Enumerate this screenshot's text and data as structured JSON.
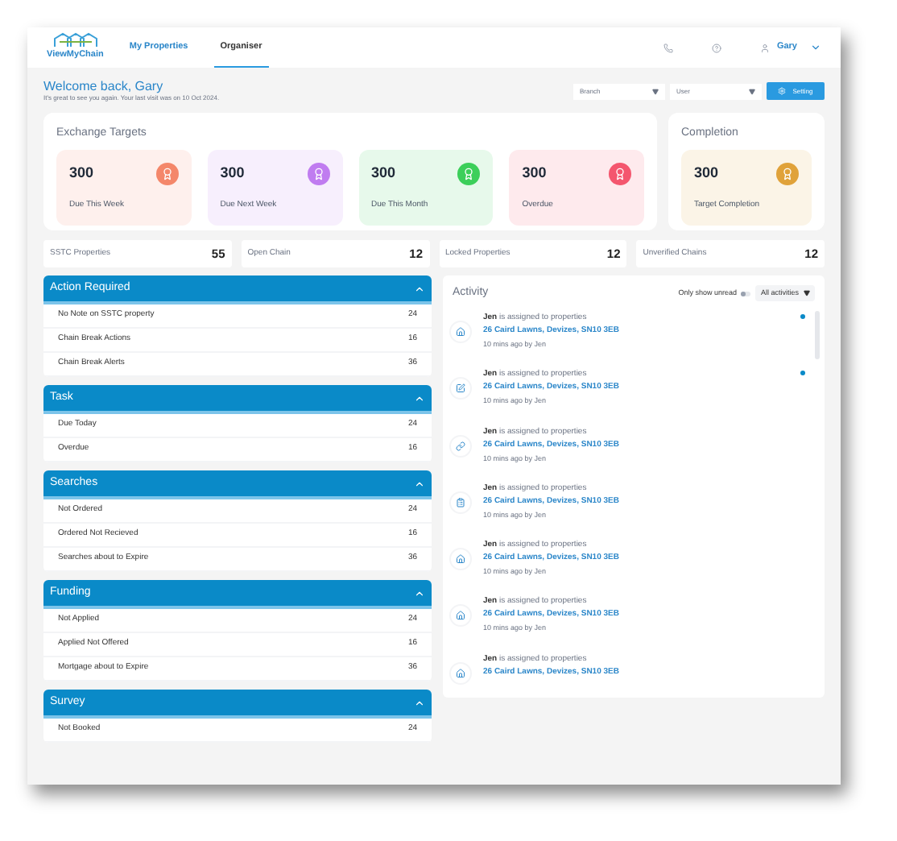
{
  "nav": {
    "logo": "ViewMyChain",
    "tabs": [
      {
        "label": "My Properties",
        "selected": false
      },
      {
        "label": "Organiser",
        "selected": true
      }
    ],
    "user": "Gary"
  },
  "welcome": {
    "title": "Welcome back, Gary",
    "subtitle": "It's great to see you again. Your last visit was on 10 Oct 2024."
  },
  "filters": [
    {
      "placeholder": "Branch"
    },
    {
      "placeholder": "User"
    }
  ],
  "setting_button": "Setting",
  "exchange_targets": {
    "title": "Exchange Targets",
    "cards": [
      {
        "value": "300",
        "label": "Due This Week",
        "color": "#f4876a"
      },
      {
        "value": "300",
        "label": "Due Next Week",
        "color": "#c07cf0"
      },
      {
        "value": "300",
        "label": "Due This Month",
        "color": "#3ccf5a"
      },
      {
        "value": "300",
        "label": "Overdue",
        "color": "#f4566e"
      }
    ]
  },
  "completion": {
    "title": "Completion",
    "cards": [
      {
        "value": "300",
        "label": "Target Completion",
        "color": "#e0a23a"
      }
    ]
  },
  "stats": [
    {
      "label": "SSTC Properties",
      "value": "55"
    },
    {
      "label": "Open Chain",
      "value": "12"
    },
    {
      "label": "Locked Properties",
      "value": "12"
    },
    {
      "label": "Unverified Chains",
      "value": "12"
    }
  ],
  "sections": [
    {
      "title": "Action Required",
      "expanded": true,
      "rows": [
        {
          "label": "No Note on SSTC property",
          "count": "24"
        },
        {
          "label": "Chain Break Actions",
          "count": "16"
        },
        {
          "label": "Chain Break Alerts",
          "count": "36"
        }
      ]
    },
    {
      "title": "Task",
      "expanded": true,
      "rows": [
        {
          "label": "Due Today",
          "count": "24"
        },
        {
          "label": "Overdue",
          "count": "16"
        }
      ]
    },
    {
      "title": "Searches",
      "expanded": true,
      "rows": [
        {
          "label": "Not Ordered",
          "count": "24"
        },
        {
          "label": "Ordered Not Recieved",
          "count": "16"
        },
        {
          "label": "Searches about to Expire",
          "count": "36"
        }
      ]
    },
    {
      "title": "Funding",
      "expanded": true,
      "rows": [
        {
          "label": "Not Applied",
          "count": "24"
        },
        {
          "label": "Applied Not Offered",
          "count": "16"
        },
        {
          "label": "Mortgage about to Expire",
          "count": "36"
        }
      ]
    },
    {
      "title": "Survey",
      "expanded": true,
      "rows": [
        {
          "label": "Not Booked",
          "count": "24"
        }
      ]
    }
  ],
  "activity": {
    "title": "Activity",
    "unread_toggle": {
      "label": "Only show unread",
      "on": false
    },
    "filter": "All activities",
    "items": [
      {
        "kind": "home",
        "actor": "Jen",
        "action": "is assigned to properties",
        "address": "26 Caird Lawns, Devizes, SN10 3EB",
        "time": "10 mins ago",
        "by": "by Jen",
        "unread": true
      },
      {
        "kind": "edit",
        "actor": "Jen",
        "action": "is assigned to properties",
        "address": "26 Caird Lawns, Devizes, SN10 3EB",
        "time": "10 mins ago",
        "by": "by Jen",
        "unread": true
      },
      {
        "kind": "link",
        "actor": "Jen",
        "action": "is assigned to properties",
        "address": "26 Caird Lawns, Devizes, SN10 3EB",
        "time": "10 mins ago",
        "by": "by Jen",
        "unread": false
      },
      {
        "kind": "clipboard",
        "actor": "Jen",
        "action": "is assigned to properties",
        "address": "26 Caird Lawns, Devizes, SN10 3EB",
        "time": "10 mins ago",
        "by": "by Jen",
        "unread": false
      },
      {
        "kind": "home",
        "actor": "Jen",
        "action": "is assigned to properties",
        "address": "26 Caird Lawns, Devizes, SN10 3EB",
        "time": "10 mins ago",
        "by": "by Jen",
        "unread": false
      },
      {
        "kind": "home",
        "actor": "Jen",
        "action": "is assigned to properties",
        "address": "26 Caird Lawns, Devizes, SN10 3EB",
        "time": "10 mins ago",
        "by": "by Jen",
        "unread": false
      },
      {
        "kind": "home",
        "actor": "Jen",
        "action": "is assigned to properties",
        "address": "26 Caird Lawns, Devizes, SN10 3EB",
        "unread": false
      }
    ]
  }
}
